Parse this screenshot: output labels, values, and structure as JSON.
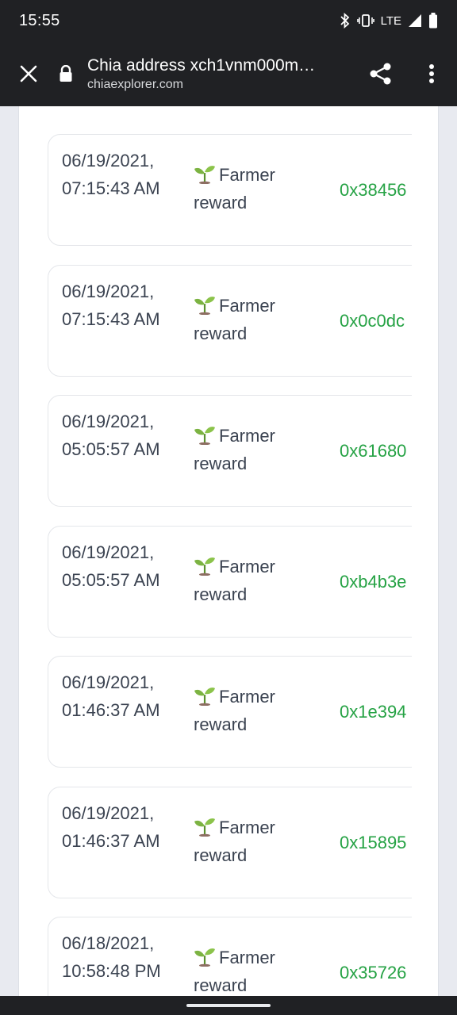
{
  "status_bar": {
    "time": "15:55",
    "network": "LTE",
    "icons": [
      "bluetooth-icon",
      "vibrate-icon",
      "signal-icon",
      "battery-icon"
    ]
  },
  "toolbar": {
    "title": "Chia address xch1vnm000m…",
    "url": "chiaexplorer.com",
    "icons": [
      "close-icon",
      "lock-icon",
      "share-icon",
      "more-vert-icon"
    ]
  },
  "transactions": [
    {
      "date": "06/19/2021, 07:15:43 AM",
      "type": "Farmer reward",
      "hash": "0x38456"
    },
    {
      "date": "06/19/2021, 07:15:43 AM",
      "type": "Farmer reward",
      "hash": "0x0c0dc"
    },
    {
      "date": "06/19/2021, 05:05:57 AM",
      "type": "Farmer reward",
      "hash": "0x61680"
    },
    {
      "date": "06/19/2021, 05:05:57 AM",
      "type": "Farmer reward",
      "hash": "0xb4b3e"
    },
    {
      "date": "06/19/2021, 01:46:37 AM",
      "type": "Farmer reward",
      "hash": "0x1e394"
    },
    {
      "date": "06/19/2021, 01:46:37 AM",
      "type": "Farmer reward",
      "hash": "0x15895"
    },
    {
      "date": "06/18/2021, 10:58:48 PM",
      "type": "Farmer reward",
      "hash": "0x35726"
    }
  ],
  "colors": {
    "toolbar_bg": "#202124",
    "hash_green": "#25a244",
    "text": "#3b4351"
  }
}
